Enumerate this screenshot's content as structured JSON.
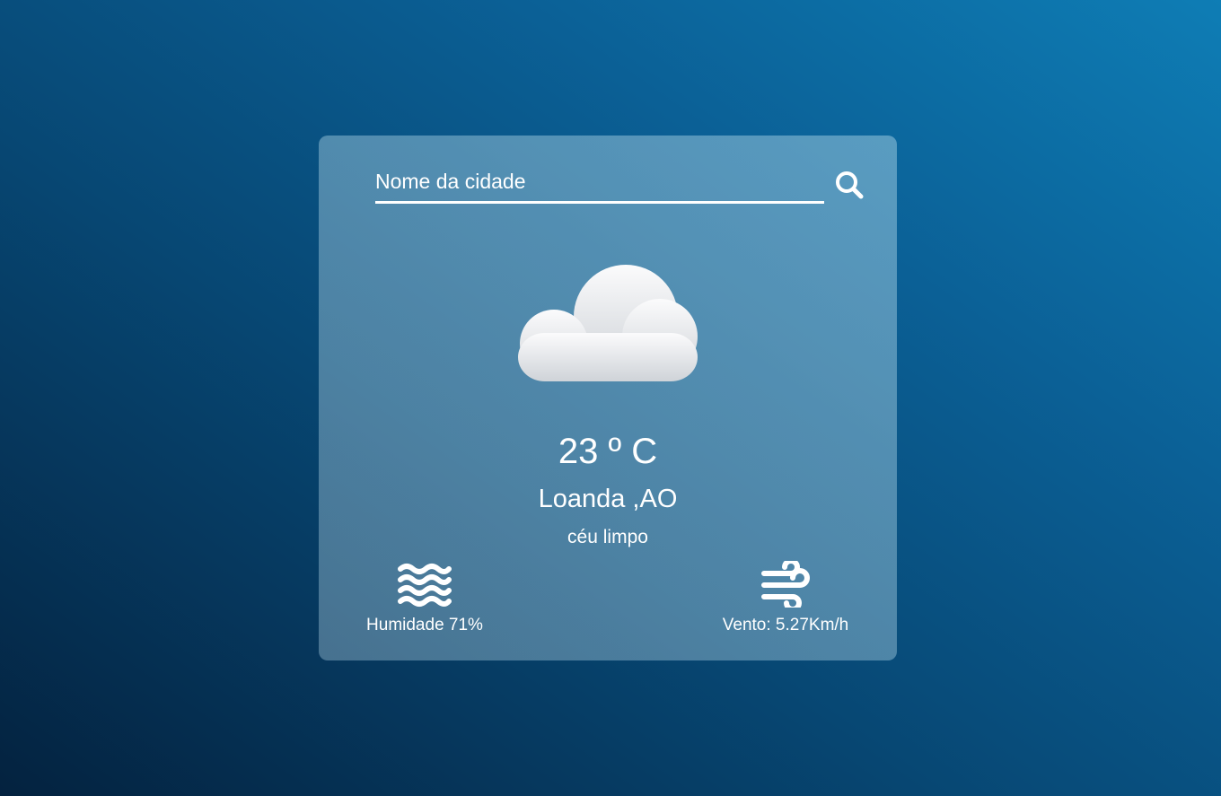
{
  "search": {
    "placeholder": "Nome da cidade",
    "value": "",
    "icon": "search-icon"
  },
  "weather": {
    "icon": "cloud-icon",
    "temperature": "23 º C",
    "location": "Loanda ,AO",
    "description": "céu limpo"
  },
  "stats": {
    "humidity": {
      "icon": "water-waves-icon",
      "label": "Humidade 71%"
    },
    "wind": {
      "icon": "wind-icon",
      "label": "Vento: 5.27Km/h"
    }
  },
  "colors": {
    "background_dark": "#04223f",
    "background_light": "#0e7db5",
    "text": "#ffffff"
  }
}
